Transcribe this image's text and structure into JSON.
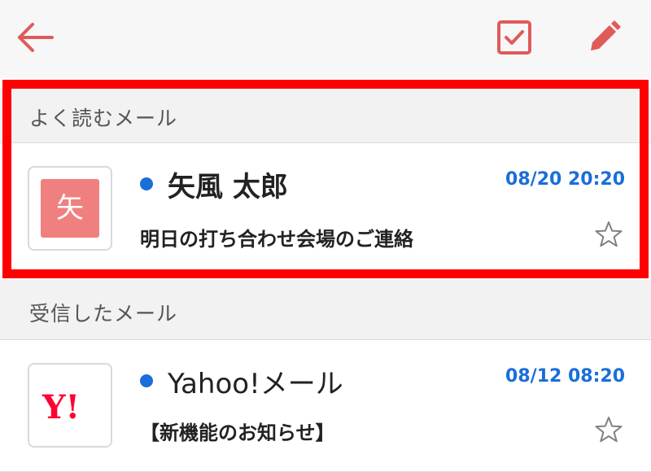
{
  "toolbar": {
    "back_icon": "arrow-left-icon",
    "select_icon": "checkbox-icon",
    "compose_icon": "pencil-icon",
    "accent_color": "#e05a5a"
  },
  "sections": [
    {
      "label": "よく読むメール",
      "items": [
        {
          "avatar_letter": "矢",
          "sender": "矢風 太郎",
          "date": "08/20 20:20",
          "subject": "明日の打ち合わせ会場のご連絡",
          "unread": true,
          "starred": false
        }
      ]
    },
    {
      "label": "受信したメール",
      "items": [
        {
          "avatar_logo": "Y!",
          "sender": "Yahoo!メール",
          "date": "08/12 08:20",
          "subject": "【新機能のお知らせ】",
          "unread": true,
          "starred": false
        }
      ]
    }
  ],
  "colors": {
    "unread_dot": "#1a6ed8",
    "date": "#1a6ed8",
    "avatar_bg": "#f08080",
    "highlight": "#ff0000"
  }
}
